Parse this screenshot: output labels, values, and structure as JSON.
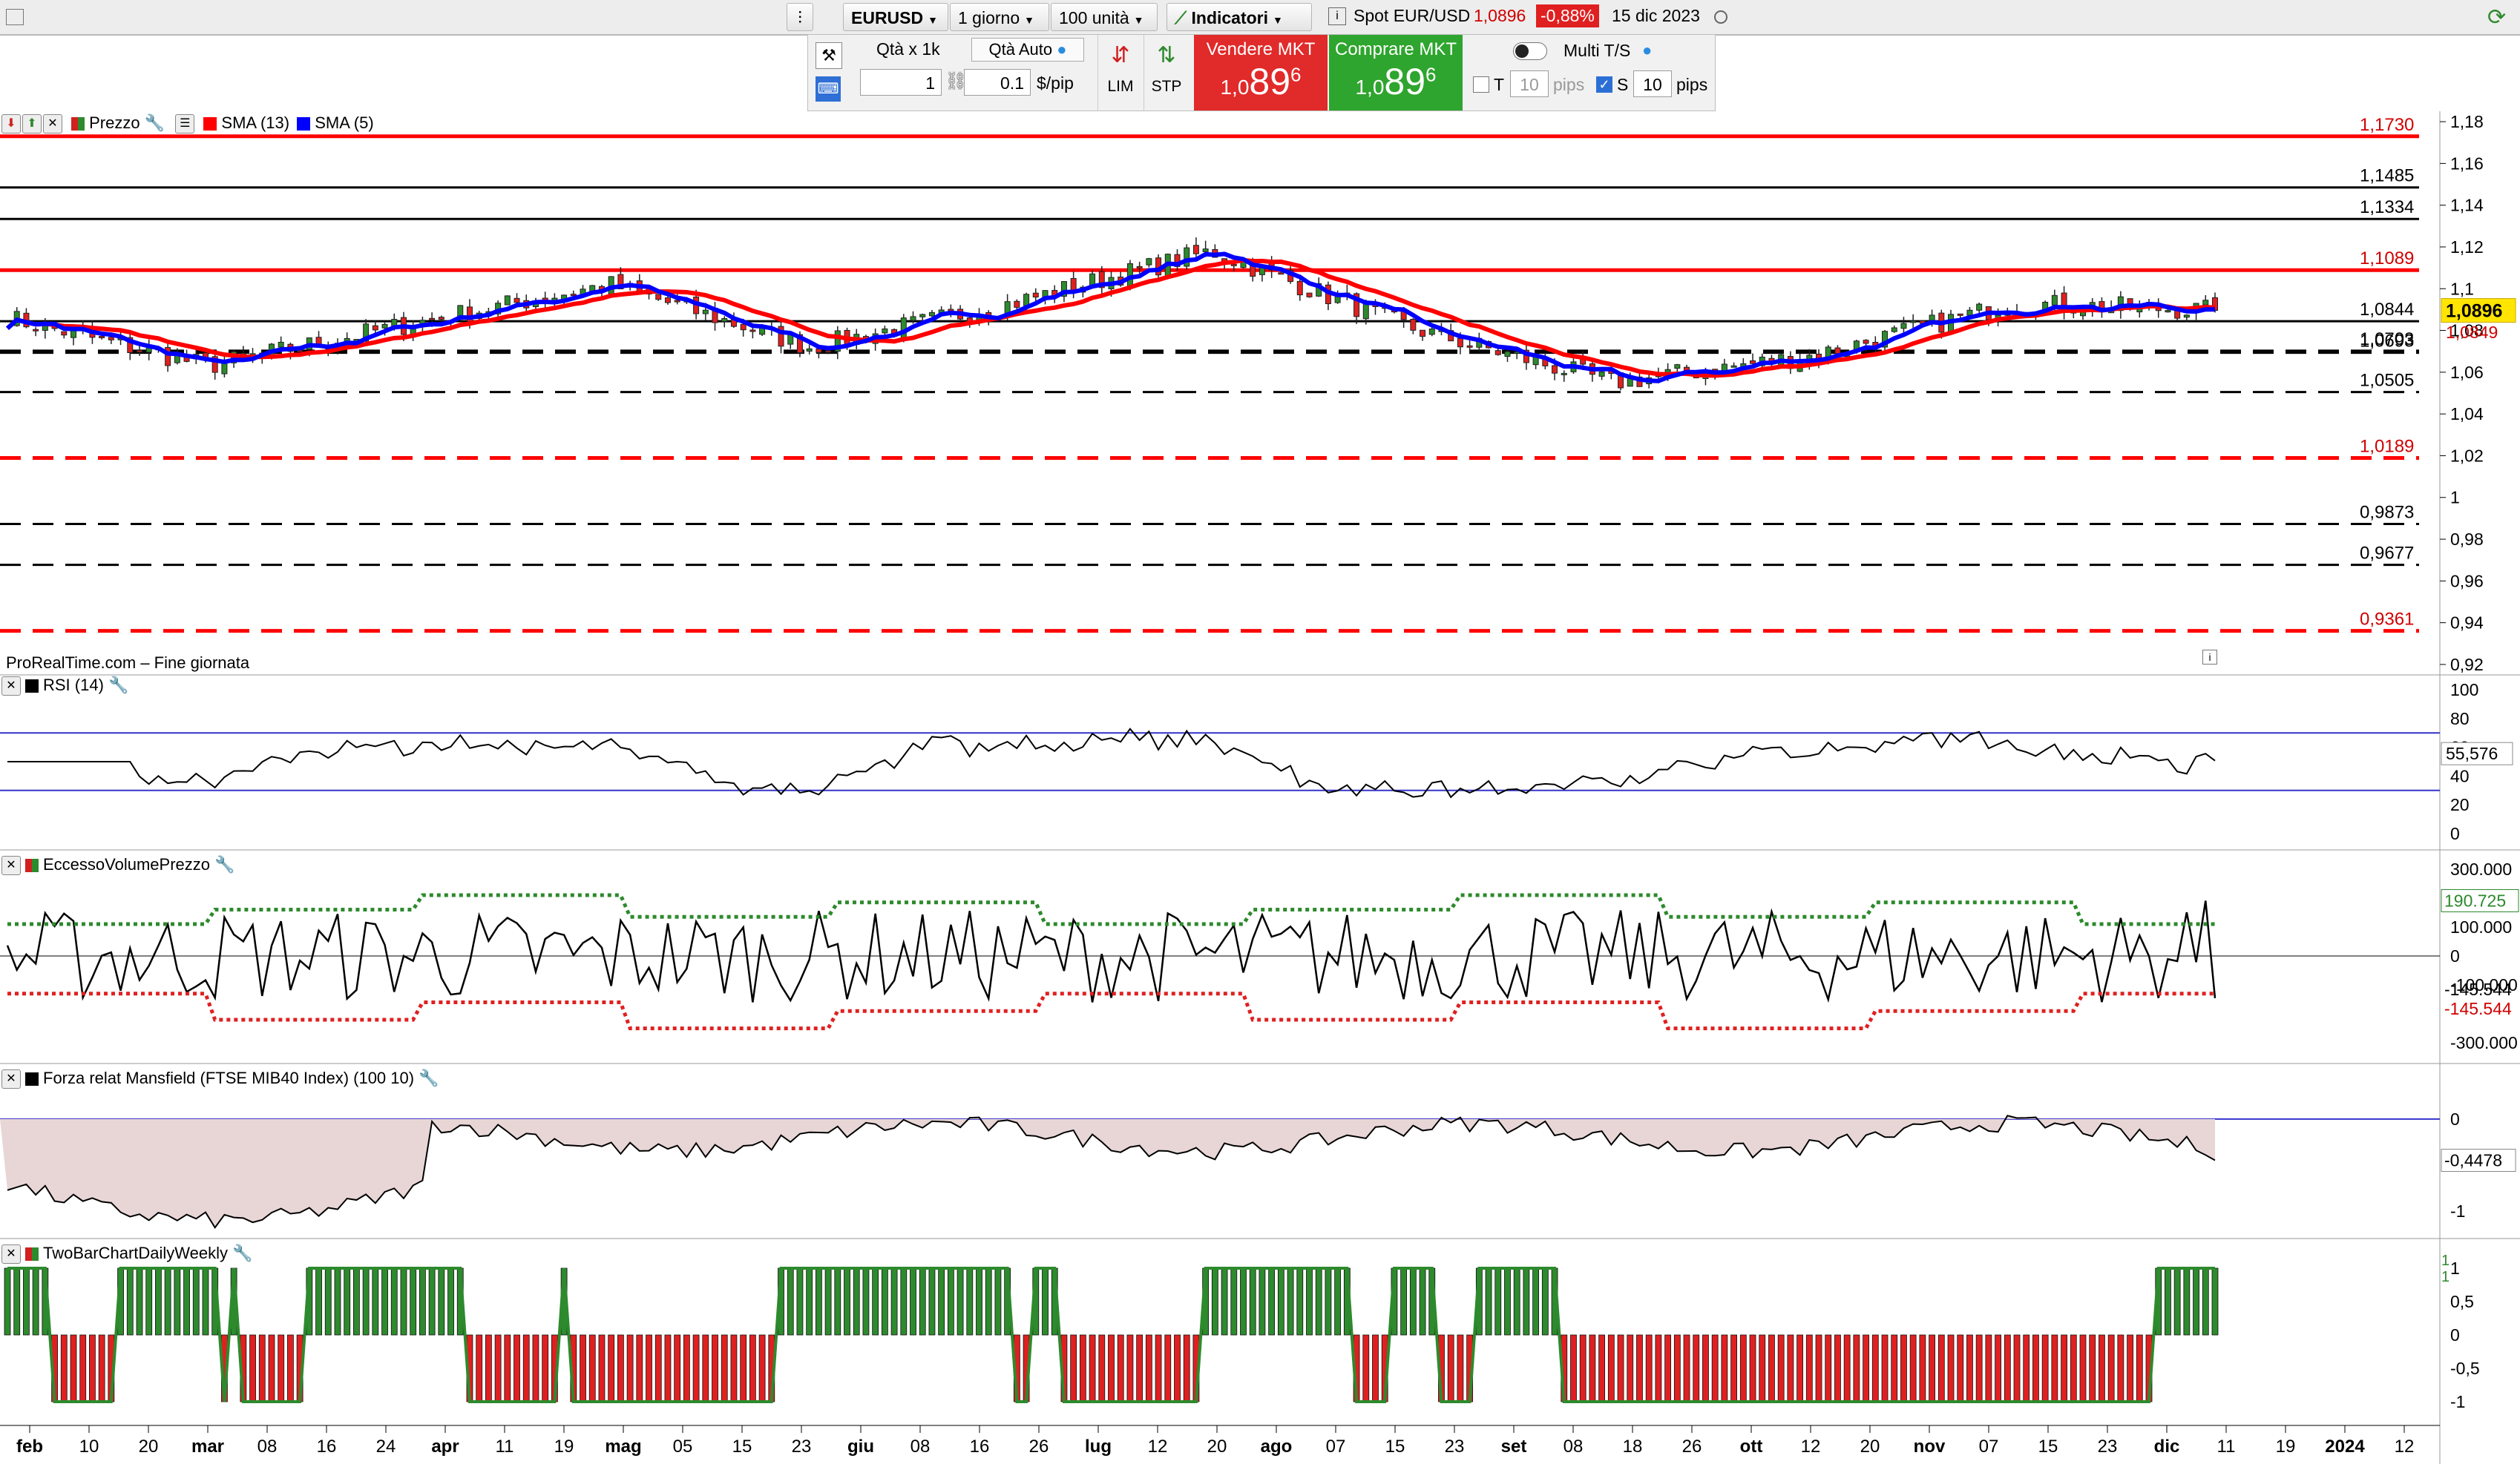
{
  "toolbar": {
    "left_icon": "window-icon",
    "symbol": "EURUSD",
    "timeframe": "1 giorno",
    "units": "100 unità",
    "indicators_label": "Indicatori",
    "spot_label": "Spot EUR/USD",
    "spot_price": "1,0896",
    "spot_change": "-0,88%",
    "spot_date": "15 dic 2023"
  },
  "order": {
    "qty_label": "Qtà",
    "qty_mult": "x 1k",
    "qty_auto": "Qtà Auto",
    "qty_value": "1",
    "pip_value": "0.1",
    "pip_unit": "$/pip",
    "lim_label": "LIM",
    "stp_label": "STP",
    "sell_label": "Vendere MKT",
    "sell_price_small": "1,0",
    "sell_price_big": "89",
    "sell_price_sup": "6",
    "buy_label": "Comprare MKT",
    "buy_price_small": "1,0",
    "buy_price_big": "89",
    "buy_price_sup": "6",
    "multi_label": "Multi T/S",
    "t_label": "T",
    "t_value": "10",
    "t_unit": "pips",
    "s_label": "S",
    "s_value": "10",
    "s_unit": "pips"
  },
  "price_panel": {
    "title": "Prezzo",
    "sma13_label": "SMA (13)",
    "sma5_label": "SMA (5)",
    "watermark": "ProRealTime.com – Fine giornata",
    "last_price": "1,0896",
    "sma_value": "1,0849",
    "colors": {
      "sma13": "#ff0000",
      "sma5": "#0000ff",
      "up": "#2d8a2d",
      "down": "#e02020"
    },
    "axis_ticks": [
      "1,18",
      "1,16",
      "1,14",
      "1,12",
      "1,1",
      "1,08",
      "1,06",
      "1,04",
      "1,02",
      "1",
      "0,98",
      "0,96",
      "0,94",
      "0,92"
    ],
    "levels": [
      {
        "label": "1,1730",
        "value": 1.173,
        "color": "#ff0000",
        "style": "solid"
      },
      {
        "label": "1,1485",
        "value": 1.1485,
        "color": "#000000",
        "style": "solid"
      },
      {
        "label": "1,1334",
        "value": 1.1334,
        "color": "#000000",
        "style": "solid"
      },
      {
        "label": "1,1089",
        "value": 1.1089,
        "color": "#ff0000",
        "style": "solid"
      },
      {
        "label": "1,0844",
        "value": 1.0844,
        "color": "#000000",
        "style": "solid"
      },
      {
        "label": "1,0703",
        "value": 1.0703,
        "color": "#000000",
        "style": "dashed"
      },
      {
        "label": "1,0693",
        "value": 1.0693,
        "color": "#000000",
        "style": "dashed"
      },
      {
        "label": "1,0505",
        "value": 1.0505,
        "color": "#000000",
        "style": "dashed"
      },
      {
        "label": "1,0189",
        "value": 1.0189,
        "color": "#ff0000",
        "style": "dashed"
      },
      {
        "label": "0,9873",
        "value": 0.9873,
        "color": "#000000",
        "style": "dashed"
      },
      {
        "label": "0,9677",
        "value": 0.9677,
        "color": "#000000",
        "style": "dashed"
      },
      {
        "label": "0,9361",
        "value": 0.9361,
        "color": "#ff0000",
        "style": "dashed"
      }
    ]
  },
  "rsi_panel": {
    "title": "RSI (14)",
    "value": "55,576",
    "axis_ticks": [
      "100",
      "80",
      "60",
      "40",
      "20",
      "0"
    ]
  },
  "evp_panel": {
    "title": "EccessoVolumePrezzo",
    "value_up": "190.725",
    "value_low": "-145.544",
    "value_low2": "-145.544",
    "axis_ticks": [
      "300.000",
      "100.000",
      "0",
      "-100.000",
      "-300.000"
    ]
  },
  "mansfield_panel": {
    "title": "Forza relat Mansfield (FTSE MIB40 Index) (100 10)",
    "value": "-0,4478",
    "axis_ticks": [
      "0",
      "-1"
    ]
  },
  "twobar_panel": {
    "title": "TwoBarChartDailyWeekly",
    "axis_ticks": [
      "1",
      "0,5",
      "0",
      "-0,5",
      "-1"
    ],
    "value_top": "1",
    "value_top2": "1"
  },
  "x_axis": {
    "labels": [
      "feb",
      "10",
      "20",
      "mar",
      "08",
      "16",
      "24",
      "apr",
      "11",
      "19",
      "mag",
      "05",
      "15",
      "23",
      "giu",
      "08",
      "16",
      "26",
      "lug",
      "12",
      "20",
      "ago",
      "07",
      "15",
      "23",
      "set",
      "08",
      "18",
      "26",
      "ott",
      "12",
      "20",
      "nov",
      "07",
      "15",
      "23",
      "dic",
      "11",
      "19",
      "2024",
      "12"
    ]
  },
  "chart_data": {
    "type": "candlestick",
    "instrument": "EURUSD",
    "timeframe": "1 giorno",
    "ylim": [
      0.915,
      1.185
    ],
    "last_close": 1.0896,
    "monthly_path": [
      {
        "x": "feb",
        "close": 1.086
      },
      {
        "x": "mar",
        "close": 1.063
      },
      {
        "x": "apr",
        "close": 1.083
      },
      {
        "x": "mag",
        "close": 1.102
      },
      {
        "x": "giu",
        "close": 1.072
      },
      {
        "x": "lug",
        "close": 1.093
      },
      {
        "x": "ago",
        "close": 1.118
      },
      {
        "x": "set",
        "close": 1.081
      },
      {
        "x": "ott",
        "close": 1.055
      },
      {
        "x": "nov",
        "close": 1.068
      },
      {
        "x": "dic",
        "close": 1.093
      },
      {
        "x": "19",
        "close": 1.0896
      }
    ],
    "rsi_last": 55.576,
    "evp_last": 190725,
    "mansfield_last": -0.4478
  }
}
